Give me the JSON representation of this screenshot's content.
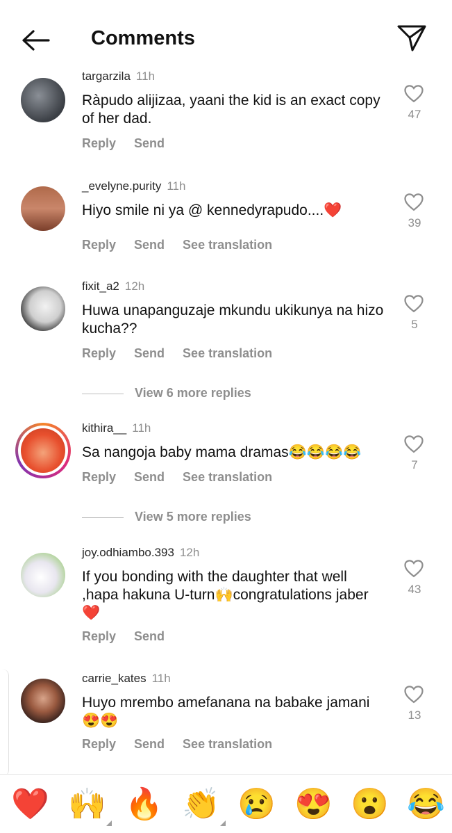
{
  "header": {
    "title": "Comments"
  },
  "actions_labels": {
    "reply": "Reply",
    "send": "Send",
    "see_translation": "See translation"
  },
  "comments": [
    {
      "user": "targarzila",
      "time": "11h",
      "text": "Ràpudo alijizaa, yaani the kid is an exact copy of her dad.",
      "likes": "47",
      "translation": false
    },
    {
      "user": "_evelyne.purity",
      "time": "11h",
      "text": "Hiyo smile ni ya @ kennedyrapudo....❤️",
      "likes": "39",
      "translation": true
    },
    {
      "user": "fixit_a2",
      "time": "12h",
      "text": "Huwa unapanguzaje mkundu ukikunya na hizo kucha??",
      "likes": "5",
      "translation": true
    },
    {
      "user": "kithira__",
      "time": "11h",
      "text": "Sa nangoja baby mama dramas😂😂😂😂",
      "likes": "7",
      "translation": true
    },
    {
      "user": "joy.odhiambo.393",
      "time": "12h",
      "text": "If you bonding with the daughter that well ,hapa hakuna U-turn🙌congratulations jaber❤️",
      "likes": "43",
      "translation": false
    },
    {
      "user": "carrie_kates",
      "time": "11h",
      "text": "Huyo mrembo amefanana na babake jamani 😍😍",
      "likes": "13",
      "translation": true
    }
  ],
  "view_more": [
    "View 6 more replies",
    "View 5 more replies"
  ],
  "emoji_bar": [
    {
      "glyph": "❤️",
      "name": "red-heart"
    },
    {
      "glyph": "🙌",
      "name": "raising-hands"
    },
    {
      "glyph": "🔥",
      "name": "fire"
    },
    {
      "glyph": "👏",
      "name": "clapping-hands"
    },
    {
      "glyph": "😢",
      "name": "crying-face"
    },
    {
      "glyph": "😍",
      "name": "heart-eyes"
    },
    {
      "glyph": "😮",
      "name": "open-mouth"
    },
    {
      "glyph": "😂",
      "name": "tears-of-joy"
    }
  ],
  "colors": {
    "accent_heart": "#e0245e",
    "muted": "#8e8e8e",
    "text": "#111111"
  }
}
